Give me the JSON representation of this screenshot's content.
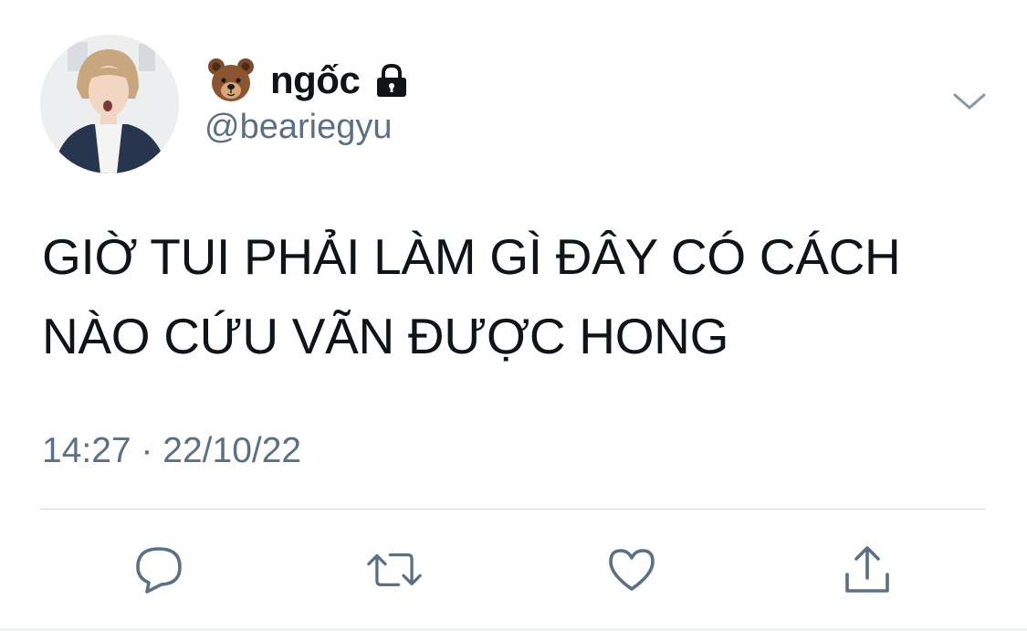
{
  "tweet": {
    "user": {
      "emoji": "bear-face-emoji",
      "display_name": "ngốc",
      "handle": "@beariegyu",
      "protected_icon": "lock-icon"
    },
    "text_line1": "GIỜ TUI PHẢI LÀM GÌ ĐÂY CÓ CÁCH",
    "text_line2": "NÀO CỨU VÃN ĐƯỢC HONG",
    "time": "14:27",
    "separator": "·",
    "date": "22/10/22"
  },
  "actions": [
    {
      "icon": "reply-icon"
    },
    {
      "icon": "retweet-icon"
    },
    {
      "icon": "like-icon"
    },
    {
      "icon": "share-icon"
    }
  ],
  "colors": {
    "text": "#0f1419",
    "secondary": "#5b7083",
    "divider": "#cfd9de",
    "icon": "#5b7083"
  }
}
